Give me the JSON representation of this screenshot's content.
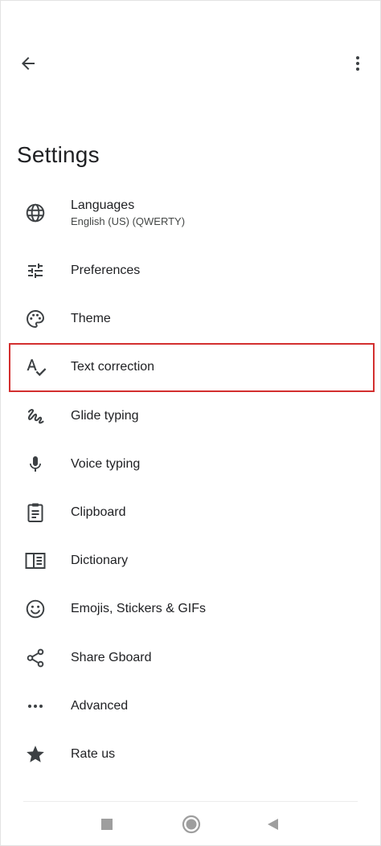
{
  "header": {
    "back_icon": "arrow-back-icon",
    "more_icon": "more-vert-icon",
    "title": "Settings"
  },
  "items": [
    {
      "label": "Languages",
      "sub": "English (US) (QWERTY)",
      "icon": "globe-icon"
    },
    {
      "label": "Preferences",
      "icon": "tune-icon"
    },
    {
      "label": "Theme",
      "icon": "palette-icon"
    },
    {
      "label": "Text correction",
      "icon": "spellcheck-icon",
      "highlighted": true
    },
    {
      "label": "Glide typing",
      "icon": "gesture-icon"
    },
    {
      "label": "Voice typing",
      "icon": "mic-icon"
    },
    {
      "label": "Clipboard",
      "icon": "clipboard-icon"
    },
    {
      "label": "Dictionary",
      "icon": "book-icon"
    },
    {
      "label": "Emojis, Stickers & GIFs",
      "icon": "smiley-icon"
    },
    {
      "label": "Share Gboard",
      "icon": "share-icon"
    },
    {
      "label": "Advanced",
      "icon": "more-horiz-icon"
    },
    {
      "label": "Rate us",
      "icon": "star-icon"
    }
  ],
  "colors": {
    "highlight": "#d32f2f",
    "icon": "#3c4043",
    "nav": "#9e9e9e"
  },
  "navbar": {
    "recent_icon": "square-icon",
    "home_icon": "circle-icon",
    "back_icon": "triangle-back-icon"
  }
}
